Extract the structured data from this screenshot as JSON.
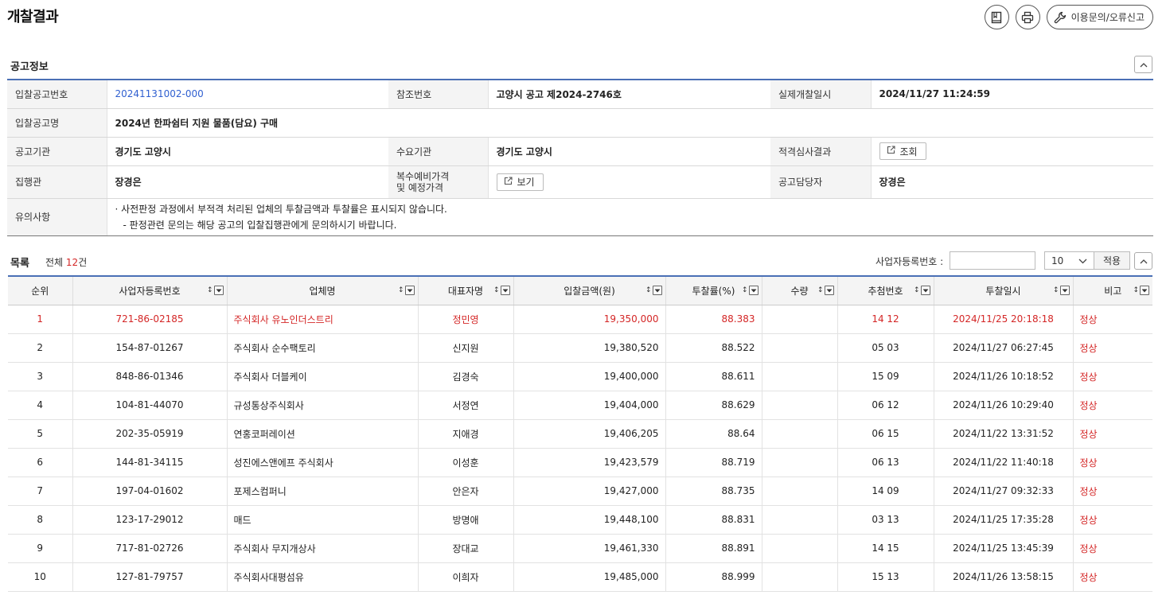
{
  "page": {
    "title": "개찰결과"
  },
  "toolbar": {
    "inquiry_label": "이용문의/오류신고",
    "bookmark_icon": "bookmark-icon",
    "print_icon": "print-icon",
    "wrench_icon": "wrench-icon"
  },
  "notice_section": {
    "title": "공고정보",
    "bid_no_label": "입찰공고번호",
    "bid_no": "20241131002-000",
    "ref_no_label": "참조번호",
    "ref_no": "고양시 공고 제2024-2746호",
    "open_dt_label": "실제개찰일시",
    "open_dt": "2024/11/27 11:24:59",
    "name_label": "입찰공고명",
    "name": "2024년 한파쉼터 지원 물품(담요) 구매",
    "agency_label": "공고기관",
    "agency": "경기도 고양시",
    "demand_label": "수요기관",
    "demand": "경기도 고양시",
    "review_label": "적격심사결과",
    "review_btn": "조회",
    "executor_label": "집행관",
    "executor": "장경은",
    "price_label_1": "복수예비가격",
    "price_label_2": "및 예정가격",
    "price_btn": "보기",
    "manager_label": "공고담당자",
    "manager": "장경은",
    "caution_label": "유의사항",
    "caution_1": "사전판정 과정에서 부적격 처리된 업체의 투찰금액과 투찰률은 표시되지 않습니다.",
    "caution_2": "판정관련 문의는 해당 공고의 입찰집행관에게 문의하시기 바랍니다."
  },
  "list": {
    "title": "목록",
    "total_prefix": "전체 ",
    "total_count": "12",
    "total_suffix": "건",
    "reg_label": "사업자등록번호 :",
    "reg_value": "",
    "page_size": "10",
    "apply_label": "적용",
    "columns": [
      "순위",
      "사업자등록번호",
      "업체명",
      "대표자명",
      "입찰금액(원)",
      "투찰률(%)",
      "수량",
      "추첨번호",
      "투찰일시",
      "비고"
    ],
    "rows": [
      {
        "rank": "1",
        "reg": "721-86-02185",
        "company": "주식회사 유노인더스트리",
        "ceo": "정민영",
        "amount": "19,350,000",
        "rate": "88.383",
        "qty": "",
        "lottery": "14 12",
        "dt": "2024/11/25 20:18:18",
        "note": "정상"
      },
      {
        "rank": "2",
        "reg": "154-87-01267",
        "company": "주식회사 순수팩토리",
        "ceo": "신지원",
        "amount": "19,380,520",
        "rate": "88.522",
        "qty": "",
        "lottery": "05 03",
        "dt": "2024/11/27 06:27:45",
        "note": "정상"
      },
      {
        "rank": "3",
        "reg": "848-86-01346",
        "company": "주식회사 더블케이",
        "ceo": "김경숙",
        "amount": "19,400,000",
        "rate": "88.611",
        "qty": "",
        "lottery": "15 09",
        "dt": "2024/11/26 10:18:52",
        "note": "정상"
      },
      {
        "rank": "4",
        "reg": "104-81-44070",
        "company": "규성통상주식회사",
        "ceo": "서정연",
        "amount": "19,404,000",
        "rate": "88.629",
        "qty": "",
        "lottery": "06 12",
        "dt": "2024/11/26 10:29:40",
        "note": "정상"
      },
      {
        "rank": "5",
        "reg": "202-35-05919",
        "company": "연홍코퍼레이션",
        "ceo": "지애경",
        "amount": "19,406,205",
        "rate": "88.64",
        "qty": "",
        "lottery": "06 15",
        "dt": "2024/11/22 13:31:52",
        "note": "정상"
      },
      {
        "rank": "6",
        "reg": "144-81-34115",
        "company": "성진에스앤에프 주식회사",
        "ceo": "이성훈",
        "amount": "19,423,579",
        "rate": "88.719",
        "qty": "",
        "lottery": "06 13",
        "dt": "2024/11/22 11:40:18",
        "note": "정상"
      },
      {
        "rank": "7",
        "reg": "197-04-01602",
        "company": "포제스컴퍼니",
        "ceo": "안은자",
        "amount": "19,427,000",
        "rate": "88.735",
        "qty": "",
        "lottery": "14 09",
        "dt": "2024/11/27 09:32:33",
        "note": "정상"
      },
      {
        "rank": "8",
        "reg": "123-17-29012",
        "company": "매드",
        "ceo": "방명애",
        "amount": "19,448,100",
        "rate": "88.831",
        "qty": "",
        "lottery": "03 13",
        "dt": "2024/11/25 17:35:28",
        "note": "정상"
      },
      {
        "rank": "9",
        "reg": "717-81-02726",
        "company": "주식회사 무지개상사",
        "ceo": "장대교",
        "amount": "19,461,330",
        "rate": "88.891",
        "qty": "",
        "lottery": "14 15",
        "dt": "2024/11/25 13:45:39",
        "note": "정상"
      },
      {
        "rank": "10",
        "reg": "127-81-79757",
        "company": "주식회사대평섬유",
        "ceo": "이희자",
        "amount": "19,485,000",
        "rate": "88.999",
        "qty": "",
        "lottery": "15 13",
        "dt": "2024/11/26 13:58:15",
        "note": "정상"
      }
    ]
  },
  "colors": {
    "accent_blue": "#4a6fb5",
    "link_blue": "#2f5fd0",
    "highlight_red": "#d42626"
  }
}
